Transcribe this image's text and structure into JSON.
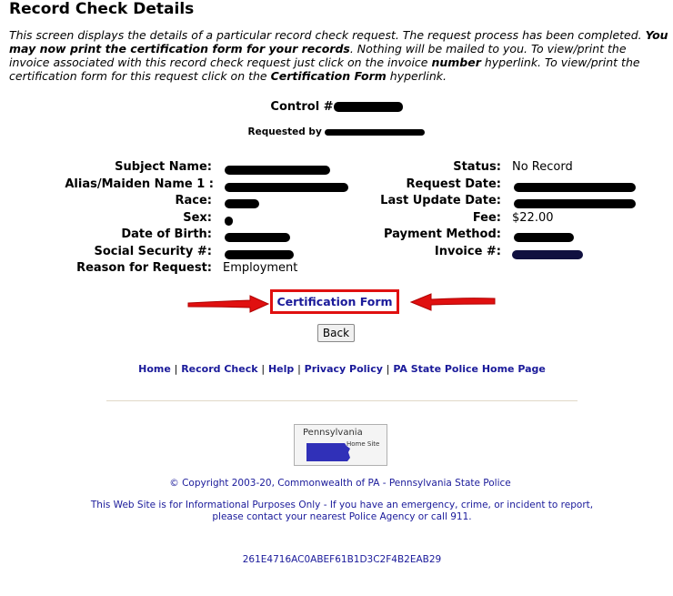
{
  "page": {
    "title": "Record Check Details",
    "intro": {
      "p1": "This screen displays the details of a particular record check request. The request process has been completed. ",
      "p2_bold": "You may now print the certification form for your records",
      "p3": ". Nothing will be mailed to you. To view/print the invoice associated with this record check request just click on the invoice ",
      "p4_bold": "number",
      "p5": " hyperlink. To view/print the certification form for this request click on the ",
      "p6_bold": "Certification Form",
      "p7": " hyperlink."
    }
  },
  "header": {
    "control_label": "Control #",
    "control_value": "",
    "requested_label": "Requested by",
    "requested_value": ""
  },
  "details_left": [
    {
      "label": "Subject Name:",
      "value": ""
    },
    {
      "label": "Alias/Maiden Name 1 :",
      "value": ""
    },
    {
      "label": "Race:",
      "value": ""
    },
    {
      "label": "Sex:",
      "value": ""
    },
    {
      "label": "Date of Birth:",
      "value": ""
    },
    {
      "label": "Social Security #:",
      "value": ""
    },
    {
      "label": "Reason for Request:",
      "value": "Employment"
    }
  ],
  "details_right": [
    {
      "label": "Status:",
      "value": "No Record"
    },
    {
      "label": "Request Date:",
      "value": ""
    },
    {
      "label": "Last Update Date:",
      "value": ""
    },
    {
      "label": "Fee:",
      "value": "$22.00"
    },
    {
      "label": "Payment Method:",
      "value": ""
    },
    {
      "label": "Invoice #:",
      "value": ""
    }
  ],
  "actions": {
    "certification_form": "Certification Form",
    "back": "Back"
  },
  "nav": {
    "home": "Home",
    "record_check": "Record Check",
    "help": "Help",
    "privacy_policy": "Privacy Policy",
    "psp_home": "PA State Police Home Page",
    "separator": "|"
  },
  "logo": {
    "line1": "Pennsylvania",
    "line2": "Home Site"
  },
  "footer": {
    "copyright": "© Copyright 2003-20, Commonwealth of PA - Pennsylvania State Police",
    "disclaimer_line1": "This Web Site is for Informational Purposes Only - If you have an emergency, crime, or incident to report,",
    "disclaimer_line2": "please contact your nearest Police Agency or call 911.",
    "hash": "261E4716AC0ABEF61B1D3C2F4B2EAB29"
  },
  "colors": {
    "link": "#1a1a9a",
    "highlight_red": "#e01010"
  }
}
